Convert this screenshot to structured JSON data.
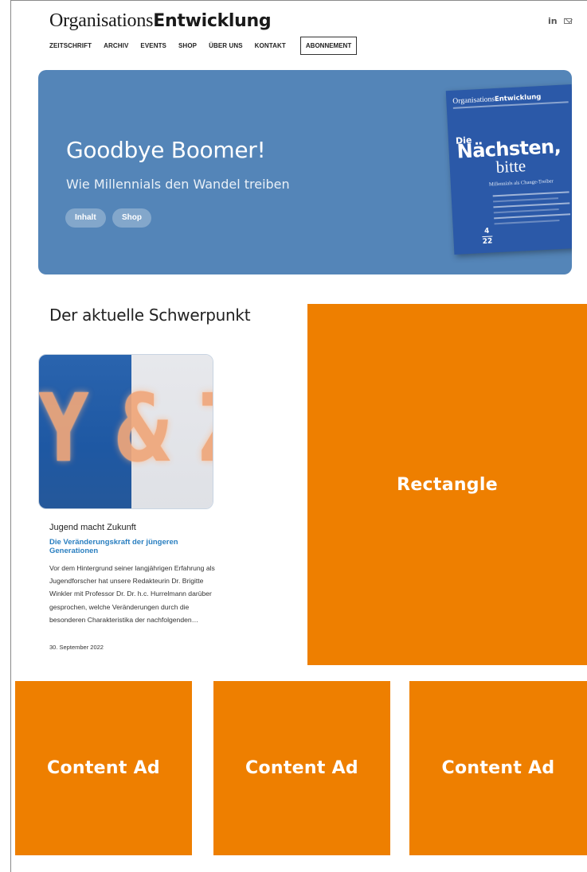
{
  "header": {
    "logo_part1": "Organisations",
    "logo_part2": "Entwicklung",
    "social": {
      "linkedin_label": "in",
      "mail_icon": "mail-icon"
    }
  },
  "nav": {
    "items": [
      "ZEITSCHRIFT",
      "ARCHIV",
      "EVENTS",
      "SHOP",
      "ÜBER UNS",
      "KONTAKT"
    ],
    "cta_label": "ABONNEMENT"
  },
  "hero": {
    "title": "Goodbye Boomer!",
    "subtitle": "Wie Millennials den Wandel treiben",
    "buttons": [
      "Inhalt",
      "Shop"
    ],
    "background_color": "#5485b8",
    "cover": {
      "logo_part1": "Organisations",
      "logo_part2": "Entwicklung",
      "die": "Die",
      "headline_1": "Nächsten,",
      "headline_2": "bitte",
      "subline": "Millennials als Change-Treiber",
      "issue_number": "4",
      "issue_year": "22"
    }
  },
  "schwerpunkt": {
    "section_title": "Der aktuelle Schwerpunkt",
    "image_text": "Y & Z",
    "kicker": "Jugend macht Zukunft",
    "headline": "Die Veränderungskraft der jüngeren Generationen",
    "body": "Vor dem Hintergrund seiner langjährigen Erfahrung als Jugendforscher hat unsere Redakteurin Dr. Brigitte Winkler mit Professor Dr. Dr. h.c. Hurrelmann darüber gesprochen, welche Veränderungen durch die besonderen Charakteristika der nachfolgenden…",
    "date": "30. September 2022"
  },
  "ads": {
    "rectangle_label": "Rectangle",
    "content_ad_labels": [
      "Content Ad",
      "Content Ad",
      "Content Ad"
    ],
    "color": "#ee7f00"
  }
}
